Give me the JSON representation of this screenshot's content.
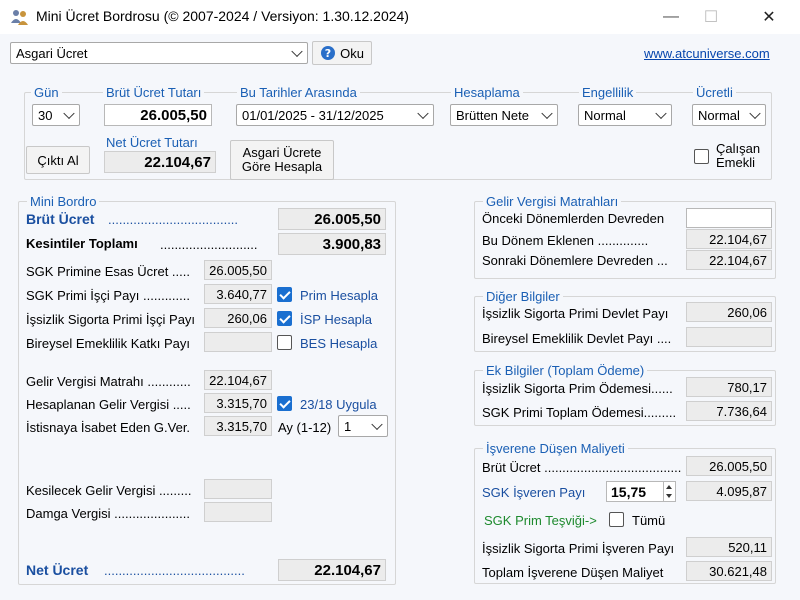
{
  "window": {
    "title": "Mini Ücret Bordrosu (© 2007-2024 / Versiyon: 1.30.12.2024)",
    "minimize": "—",
    "maximize": "☐",
    "close": "✕"
  },
  "toolbar": {
    "type_select": "Asgari Ücret",
    "read_button": "Oku",
    "website": "www.atcuniverse.com"
  },
  "params": {
    "gun_label": "Gün",
    "gun_value": "30",
    "brut_label": "Brüt Ücret Tutarı",
    "brut_value": "26.005,50",
    "tarih_label": "Bu Tarihler Arasında",
    "tarih_value": "01/01/2025 - 31/12/2025",
    "hesaplama_label": "Hesaplama",
    "hesaplama_value": "Brütten Nete",
    "engellilik_label": "Engellilik",
    "engellilik_value": "Normal",
    "ucretli_label": "Ücretli",
    "ucretli_value": "Normal",
    "cikti_button": "Çıktı Al",
    "net_label": "Net Ücret Tutarı",
    "net_value": "22.104,67",
    "asgari_button_line1": "Asgari Ücrete",
    "asgari_button_line2": "Göre Hesapla",
    "calisan_emekli_line1": "Çalışan",
    "calisan_emekli_line2": "Emekli",
    "calisan_emekli_checked": false
  },
  "mini_bordro": {
    "title": "Mini Bordro",
    "brut_ucret_label": "Brüt Ücret",
    "brut_ucret_dots": "....................................",
    "brut_ucret_value": "26.005,50",
    "kesintiler_label": "Kesintiler Toplamı",
    "kesintiler_dots": "...........................",
    "kesintiler_value": "3.900,83",
    "rows": [
      {
        "label": "SGK Primine Esas Ücret .....",
        "value": "26.005,50"
      },
      {
        "label": "SGK Primi İşçi Payı .............",
        "value": "3.640,77",
        "check_label": "Prim Hesapla",
        "checked": true
      },
      {
        "label": "İşsizlik Sigorta Primi İşçi Payı",
        "value": "260,06",
        "check_label": "İSP Hesapla",
        "checked": true
      },
      {
        "label": "Bireysel Emeklilik Katkı Payı",
        "value": "",
        "check_label": "BES Hesapla",
        "checked": false
      },
      {
        "label": "Gelir Vergisi Matrahı ............",
        "value": "22.104,67"
      },
      {
        "label": "Hesaplanan Gelir Vergisi .....",
        "value": "3.315,70",
        "check_label": "23/18 Uygula",
        "checked": true
      },
      {
        "label": "İstisnaya İsabet Eden G.Ver.",
        "value": "3.315,70"
      },
      {
        "label": "Kesilecek Gelir Vergisi .........",
        "value": ""
      },
      {
        "label": "Damga Vergisi .....................",
        "value": ""
      }
    ],
    "ay_label": "Ay (1-12)",
    "ay_value": "1",
    "net_ucret_label": "Net Ücret",
    "net_ucret_dots": ".......................................",
    "net_ucret_value": "22.104,67"
  },
  "gelir_vergisi": {
    "title": "Gelir Vergisi Matrahları",
    "rows": [
      {
        "label": "Önceki Dönemlerden Devreden",
        "value": ""
      },
      {
        "label": "Bu Dönem Eklenen ..............",
        "value": "22.104,67"
      },
      {
        "label": "Sonraki Dönemlere Devreden ...",
        "value": "22.104,67"
      }
    ]
  },
  "diger": {
    "title": "Diğer Bilgiler",
    "rows": [
      {
        "label": "İşsizlik Sigorta Primi Devlet Payı",
        "value": "260,06"
      },
      {
        "label": "Bireysel Emeklilik Devlet Payı ....",
        "value": ""
      }
    ]
  },
  "ek_bilgiler": {
    "title": "Ek Bilgiler (Toplam Ödeme)",
    "rows": [
      {
        "label": "İşsizlik Sigorta Prim Ödemesi......",
        "value": "780,17"
      },
      {
        "label": "SGK Primi Toplam Ödemesi.........",
        "value": "7.736,64"
      }
    ]
  },
  "isveren": {
    "title": "İşverene Düşen Maliyeti",
    "brut_label": "Brüt Ücret .........................................",
    "brut_value": "26.005,50",
    "sgk_label": "SGK İşveren Payı",
    "sgk_rate": "15,75",
    "sgk_value": "4.095,87",
    "tesvik_label": "SGK Prim Teşviği->",
    "tumu_label": "Tümü",
    "tumu_checked": false,
    "issizlik_label": "İşsizlik Sigorta Primi İşveren Payı",
    "issizlik_value": "520,11",
    "toplam_label": "Toplam İşverene Düşen Maliyet",
    "toplam_value": "30.621,48"
  }
}
